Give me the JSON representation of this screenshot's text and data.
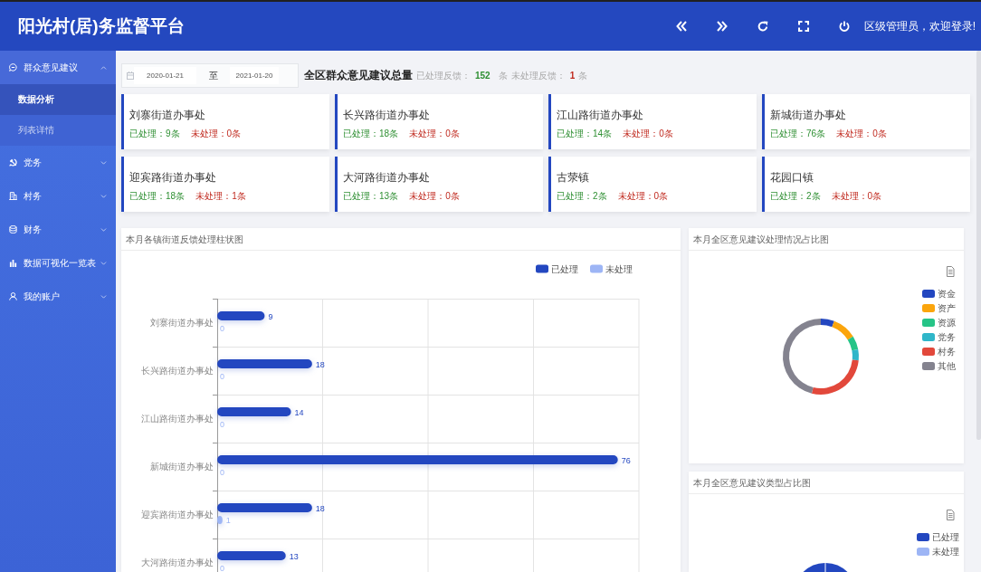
{
  "header": {
    "title": "阳光村(居)务监督平台",
    "welcome": "区级管理员，欢迎登录!"
  },
  "sidebar": {
    "items": [
      {
        "label": "群众意见建议",
        "expanded": true,
        "children": [
          {
            "label": "数据分析",
            "selected": true
          },
          {
            "label": "列表详情",
            "selected": false
          }
        ]
      },
      {
        "label": "党务",
        "expanded": false
      },
      {
        "label": "村务",
        "expanded": false
      },
      {
        "label": "财务",
        "expanded": false
      },
      {
        "label": "数据可视化一览表",
        "expanded": false
      },
      {
        "label": "我的账户",
        "expanded": false
      }
    ]
  },
  "filter": {
    "start_date": "2020-01-21",
    "separator": "至",
    "end_date": "2021-01-20"
  },
  "summary": {
    "title": "全区群众意见建议总量",
    "processed_label": "已处理反馈：",
    "processed_count": "152",
    "processed_unit": "条",
    "pending_label": "未处理反馈：",
    "pending_count": "1",
    "pending_unit": "条"
  },
  "offices": [
    {
      "name": "刘寨街道办事处",
      "processed": "已处理：9条",
      "pending": "未处理：0条"
    },
    {
      "name": "长兴路街道办事处",
      "processed": "已处理：18条",
      "pending": "未处理：0条"
    },
    {
      "name": "江山路街道办事处",
      "processed": "已处理：14条",
      "pending": "未处理：0条"
    },
    {
      "name": "新城街道办事处",
      "processed": "已处理：76条",
      "pending": "未处理：0条"
    },
    {
      "name": "迎宾路街道办事处",
      "processed": "已处理：18条",
      "pending": "未处理：1条"
    },
    {
      "name": "大河路街道办事处",
      "processed": "已处理：13条",
      "pending": "未处理：0条"
    },
    {
      "name": "古荥镇",
      "processed": "已处理：2条",
      "pending": "未处理：0条"
    },
    {
      "name": "花园口镇",
      "processed": "已处理：2条",
      "pending": "未处理：0条"
    }
  ],
  "bar_panel": {
    "title": "本月各镇街道反馈处理柱状图",
    "chart_data": {
      "type": "bar",
      "orientation": "horizontal",
      "categories": [
        "刘寨街道办事处",
        "长兴路街道办事处",
        "江山路街道办事处",
        "新城街道办事处",
        "迎宾路街道办事处",
        "大河路街道办事处"
      ],
      "series": [
        {
          "name": "已处理",
          "color": "#2347c0",
          "values": [
            9,
            18,
            14,
            76,
            18,
            13
          ]
        },
        {
          "name": "未处理",
          "color": "#9db5f5",
          "values": [
            0,
            0,
            0,
            0,
            1,
            0
          ]
        }
      ],
      "xlim": [
        0,
        80
      ],
      "data_labels": true,
      "legend": true
    }
  },
  "status_panel": {
    "title": "本月全区意见建议处理情况占比图",
    "legend": [
      {
        "label": "资金",
        "color": "#2347c0"
      },
      {
        "label": "资产",
        "color": "#fba50c"
      },
      {
        "label": "资源",
        "color": "#26c487"
      },
      {
        "label": "党务",
        "color": "#2fb6c9"
      },
      {
        "label": "村务",
        "color": "#e2483b"
      },
      {
        "label": "其他",
        "color": "#84838f"
      }
    ]
  },
  "type_panel": {
    "title": "本月全区意见建议类型占比图",
    "legend": [
      {
        "label": "已处理",
        "color": "#2347c0"
      },
      {
        "label": "未处理",
        "color": "#9db5f5"
      }
    ]
  }
}
